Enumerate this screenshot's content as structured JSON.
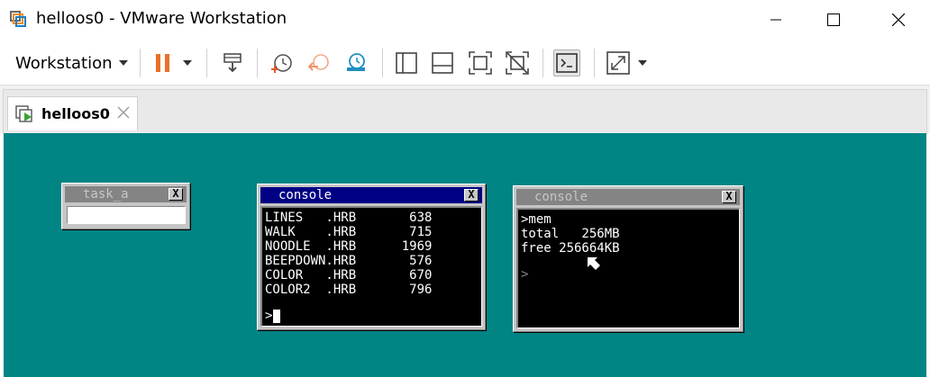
{
  "window": {
    "title": "helloos0 - VMware Workstation"
  },
  "toolbar": {
    "menu_label": "Workstation",
    "icons": [
      "pause-icon",
      "send-keys-icon",
      "snapshot-take-icon",
      "snapshot-revert-icon",
      "snapshot-manager-icon",
      "sidebar-view-icon",
      "thumbnail-view-icon",
      "fullscreen-icon",
      "unity-icon",
      "console-view-icon",
      "stretch-guest-icon"
    ],
    "accent_pause": "#e8702a",
    "accent_snapshot": "#1f8fc0"
  },
  "tab": {
    "label": "helloos0"
  },
  "screen": {
    "background": "#008484"
  },
  "guest": {
    "task_a": {
      "title": "task_a",
      "close": "X"
    },
    "console1": {
      "title": "console",
      "close": "X",
      "lines": [
        "LINES   .HRB       638",
        "WALK    .HRB       715",
        "NOODLE  .HRB      1969",
        "BEEPDOWN.HRB       576",
        "COLOR   .HRB       670",
        "COLOR2  .HRB       796"
      ],
      "prompt": ">"
    },
    "console2": {
      "title": "console",
      "close": "X",
      "lines": [
        ">mem",
        "total   256MB",
        "free 256664KB"
      ],
      "prompt": ">"
    }
  }
}
